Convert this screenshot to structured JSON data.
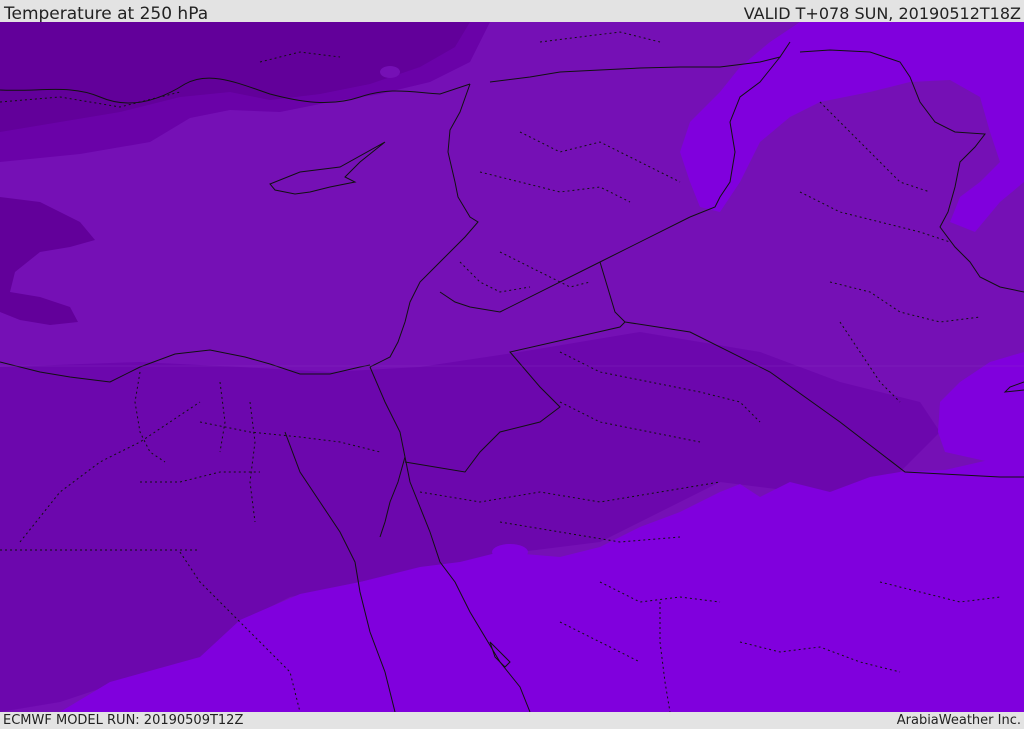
{
  "header": {
    "title": "Temperature at 250 hPa",
    "valid": "VALID T+078 SUN, 20190512T18Z"
  },
  "footer": {
    "model_run": "ECMWF MODEL RUN: 20190509T12Z",
    "credit": "ArabiaWeather Inc."
  },
  "map": {
    "colors": {
      "coldest": "#62009a",
      "cold": "#6a02a8",
      "mid": "#7510b5",
      "warm": "#8000dd",
      "border": "#111111"
    }
  }
}
